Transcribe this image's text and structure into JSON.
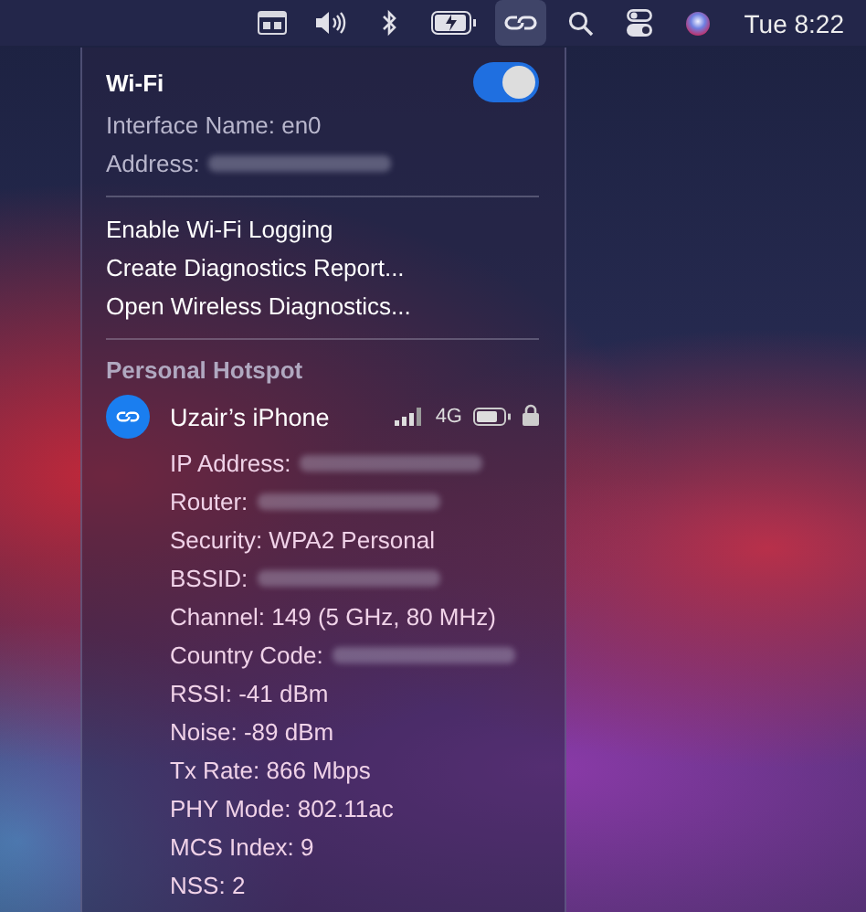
{
  "menubar": {
    "items": [
      {
        "kind": "display",
        "selected": false
      },
      {
        "kind": "volume",
        "selected": false
      },
      {
        "kind": "bluetooth",
        "selected": false
      },
      {
        "kind": "battery",
        "selected": false
      },
      {
        "kind": "hotspot",
        "selected": true
      },
      {
        "kind": "search",
        "selected": false
      },
      {
        "kind": "controls",
        "selected": false
      },
      {
        "kind": "siri",
        "selected": false
      }
    ],
    "clock": "Tue 8:22"
  },
  "wifi": {
    "title": "Wi-Fi",
    "on": true,
    "info": [
      {
        "text": "Interface Name: en0",
        "redacted": false
      },
      {
        "text": "Address:",
        "redacted": true
      }
    ],
    "actions": [
      "Enable Wi-Fi Logging",
      "Create Diagnostics Report...",
      "Open Wireless Diagnostics..."
    ],
    "section": "Personal Hotspot",
    "device": {
      "name": "Uzair’s iPhone",
      "network": "4G",
      "locked": true,
      "details": [
        {
          "text": "IP Address:",
          "redacted": true
        },
        {
          "text": "Router:",
          "redacted": true
        },
        {
          "text": "Security: WPA2 Personal",
          "redacted": false
        },
        {
          "text": "BSSID:",
          "redacted": true
        },
        {
          "text": "Channel: 149 (5 GHz, 80 MHz)",
          "redacted": false
        },
        {
          "text": "Country Code:",
          "redacted": true
        },
        {
          "text": "RSSI: -41 dBm",
          "redacted": false
        },
        {
          "text": "Noise: -89 dBm",
          "redacted": false
        },
        {
          "text": "Tx Rate: 866 Mbps",
          "redacted": false
        },
        {
          "text": "PHY Mode: 802.11ac",
          "redacted": false
        },
        {
          "text": "MCS Index: 9",
          "redacted": false
        },
        {
          "text": "NSS: 2",
          "redacted": false
        }
      ]
    }
  }
}
